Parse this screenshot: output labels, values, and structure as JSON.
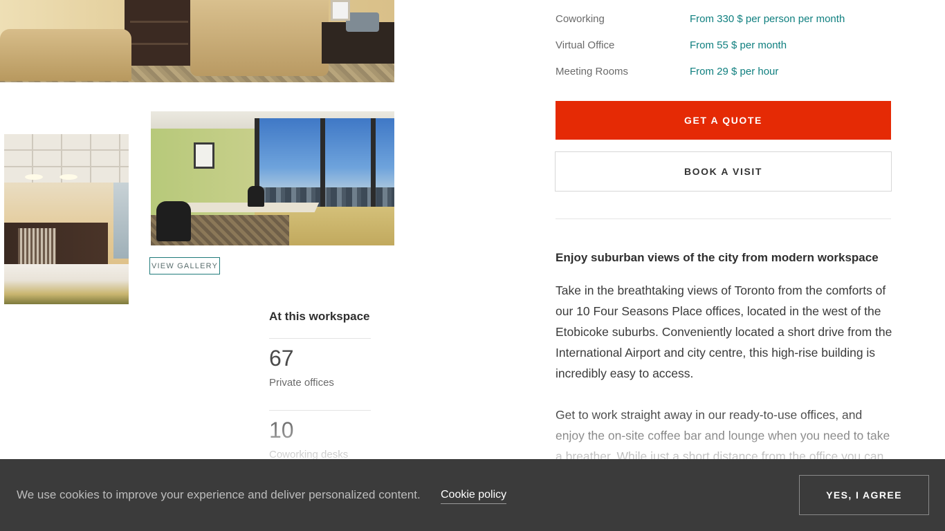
{
  "gallery": {
    "view_gallery_label": "VIEW GALLERY"
  },
  "workspace": {
    "heading": "At this workspace",
    "stats": [
      {
        "value": "67",
        "label": "Private offices"
      },
      {
        "value": "10",
        "label": "Coworking desks"
      }
    ]
  },
  "pricing": [
    {
      "name": "Coworking",
      "price": "From 330 $ per person per month"
    },
    {
      "name": "Virtual Office",
      "price": "From 55 $ per month"
    },
    {
      "name": "Meeting Rooms",
      "price": "From 29 $ per hour"
    }
  ],
  "actions": {
    "quote_label": "GET A QUOTE",
    "visit_label": "BOOK A VISIT",
    "quote_color": "#e52a05"
  },
  "description": {
    "heading": "Enjoy suburban views of the city from modern workspace",
    "paragraphs": [
      "Take in the breathtaking views of Toronto from the comforts of our 10 Four Seasons Place offices, located in the west of the Etobicoke suburbs. Conveniently located a short drive from the International Airport and city centre, this high-rise building is incredibly easy to access.",
      "Get to work straight away in our ready-to-use offices, and enjoy the on-site coffee bar and lounge when you need to take a breather. While just a short distance from the office you can"
    ]
  },
  "cookie": {
    "text": "We use cookies to improve your experience and deliver personalized content.",
    "policy_link": "Cookie policy",
    "agree_label": "YES, I AGREE"
  },
  "colors": {
    "accent_teal": "#0f7f7f",
    "cookie_bar": "#3b3b3b"
  }
}
